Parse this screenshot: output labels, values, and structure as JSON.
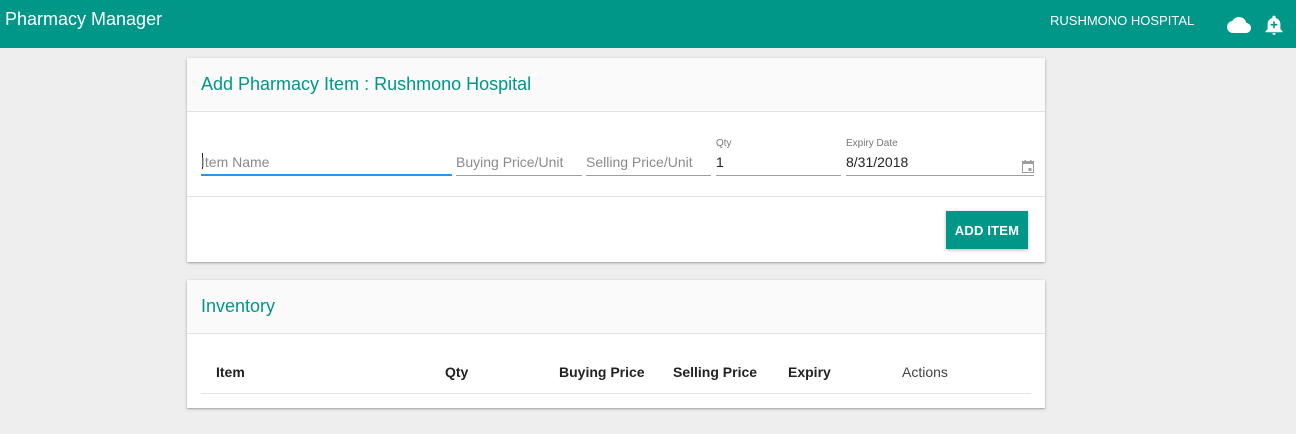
{
  "app": {
    "title": "Pharmacy Manager",
    "hospital": "RUSHMONO HOSPITAL",
    "icons": [
      "cloud-icon",
      "add-alert-icon"
    ],
    "colors": {
      "primary": "#009688",
      "focus": "#2196f3",
      "background": "#eeeeee"
    }
  },
  "add_card": {
    "title": "Add Pharmacy Item : Rushmono Hospital",
    "fields": {
      "item_name": {
        "placeholder": "Item Name",
        "value": ""
      },
      "buying_price": {
        "placeholder": "Buying Price/Unit",
        "value": ""
      },
      "selling_price": {
        "placeholder": "Selling Price/Unit",
        "value": ""
      },
      "qty": {
        "label": "Qty",
        "value": "1"
      },
      "expiry": {
        "label": "Expiry Date",
        "value": "8/31/2018"
      }
    },
    "add_button": "ADD ITEM"
  },
  "inventory": {
    "title": "Inventory",
    "columns": [
      "Item",
      "Qty",
      "Buying Price",
      "Selling Price",
      "Expiry",
      "Actions"
    ],
    "rows": []
  }
}
